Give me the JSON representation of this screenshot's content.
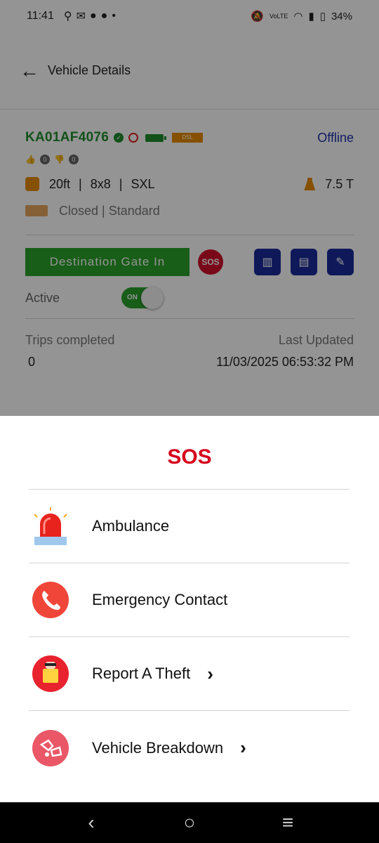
{
  "status_bar": {
    "time": "11:41",
    "network": "VoLTE",
    "battery": "34%"
  },
  "header": {
    "title": "Vehicle Details"
  },
  "vehicle": {
    "plate": "KA01AF4076",
    "fuel_tag": "DSL",
    "status": "Offline",
    "likes": "0",
    "dislikes": "0",
    "length": "20ft",
    "axle": "8x8",
    "size": "SXL",
    "capacity": "7.5 T",
    "body": "Closed | Standard",
    "gate_button": "Destination Gate In",
    "sos_badge": "SOS",
    "active_label": "Active",
    "toggle_label": "ON",
    "trips_label": "Trips completed",
    "trips_value": "0",
    "updated_label": "Last Updated",
    "updated_value": "11/03/2025 06:53:32 PM"
  },
  "sos_sheet": {
    "title": "SOS",
    "items": [
      {
        "label": "Ambulance",
        "icon": "siren-icon",
        "chevron": ""
      },
      {
        "label": "Emergency Contact",
        "icon": "phone-icon",
        "chevron": ""
      },
      {
        "label": "Report A Theft",
        "icon": "thief-icon",
        "chevron": "›"
      },
      {
        "label": "Vehicle Breakdown",
        "icon": "breakdown-icon",
        "chevron": "›"
      }
    ]
  },
  "colors": {
    "plate_green": "#1f8c2e",
    "accent_blue": "#1b2c9a",
    "sos_red": "#d6001c",
    "button_green": "#2aa02a"
  }
}
